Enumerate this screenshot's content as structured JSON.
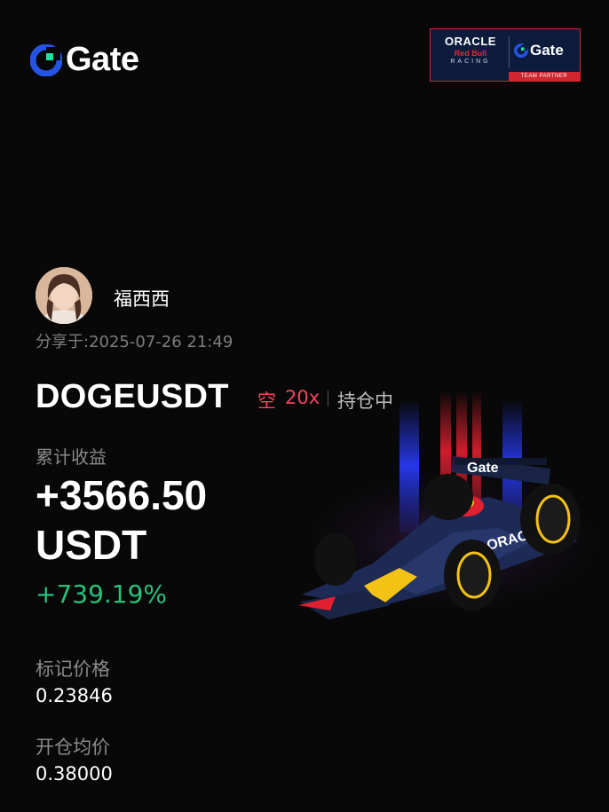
{
  "brand": {
    "name": "Gate",
    "logo_icon": "gate-logo-icon"
  },
  "partner_badge": {
    "oracle": "ORACLE",
    "red_bull": "Red Bull",
    "racing": "RACING",
    "gate": "Gate",
    "caption": "TEAM PARTNER"
  },
  "user": {
    "name": "福西西",
    "avatar_icon": "avatar"
  },
  "share": {
    "label": "分享于:",
    "timestamp": "2025-07-26 21:49"
  },
  "position": {
    "pair": "DOGEUSDT",
    "side": "空",
    "leverage": "20x",
    "status": "持仓中"
  },
  "pnl": {
    "label": "累计收益",
    "value": "+3566.50",
    "unit": "USDT",
    "percent": "+739.19%"
  },
  "mark_price": {
    "label": "标记价格",
    "value": "0.23846"
  },
  "entry_price": {
    "label": "开仓均价",
    "value": "0.38000"
  },
  "colors": {
    "background": "#080808",
    "short": "#f0475d",
    "profit": "#28c17b",
    "brand_blue": "#2354e6",
    "brand_green": "#17e6a1"
  }
}
